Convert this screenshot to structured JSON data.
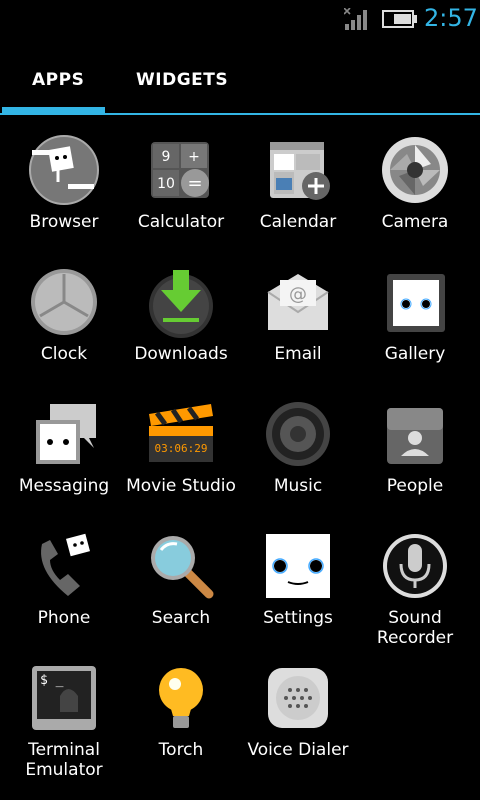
{
  "status_bar": {
    "time": "2:57"
  },
  "tabs": {
    "apps": "APPS",
    "widgets": "WIDGETS"
  },
  "apps": [
    {
      "label": "Browser"
    },
    {
      "label": "Calculator",
      "icon_text": [
        "9",
        "+",
        "10",
        "="
      ]
    },
    {
      "label": "Calendar"
    },
    {
      "label": "Camera"
    },
    {
      "label": "Clock"
    },
    {
      "label": "Downloads"
    },
    {
      "label": "Email"
    },
    {
      "label": "Gallery"
    },
    {
      "label": "Messaging"
    },
    {
      "label": "Movie Studio",
      "icon_text": "03:06:29"
    },
    {
      "label": "Music"
    },
    {
      "label": "People"
    },
    {
      "label": "Phone"
    },
    {
      "label": "Search"
    },
    {
      "label": "Settings"
    },
    {
      "label": "Sound Recorder"
    },
    {
      "label": "Terminal Emulator",
      "icon_text": "$ _"
    },
    {
      "label": "Torch"
    },
    {
      "label": "Voice Dialer"
    }
  ]
}
